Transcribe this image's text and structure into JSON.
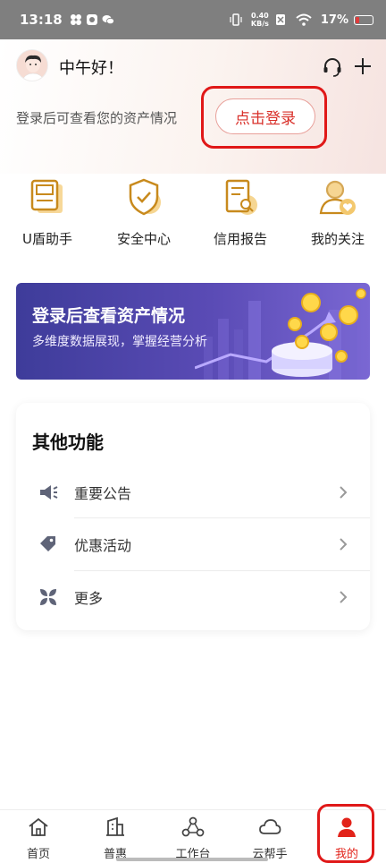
{
  "status_bar": {
    "time": "13:18",
    "net_speed_top": "0.40",
    "net_speed_bottom": "KB/s",
    "battery": "17%"
  },
  "header": {
    "greeting": "中午好！",
    "login_hint": "登录后可查看您的资产情况",
    "login_button": "点击登录"
  },
  "quick_actions": [
    {
      "label": "U盾助手",
      "icon": "u-shield-icon"
    },
    {
      "label": "安全中心",
      "icon": "security-shield-icon"
    },
    {
      "label": "信用报告",
      "icon": "credit-report-icon"
    },
    {
      "label": "我的关注",
      "icon": "my-favorites-icon"
    }
  ],
  "banner": {
    "title": "登录后查看资产情况",
    "subtitle": "多维度数据展现，掌握经营分析"
  },
  "other_functions": {
    "title": "其他功能",
    "items": [
      {
        "label": "重要公告",
        "icon": "announcement-icon"
      },
      {
        "label": "优惠活动",
        "icon": "promotion-tag-icon"
      },
      {
        "label": "更多",
        "icon": "more-grid-icon"
      }
    ]
  },
  "bottom_nav": [
    {
      "label": "首页",
      "icon": "home-icon"
    },
    {
      "label": "普惠",
      "icon": "building-icon"
    },
    {
      "label": "工作台",
      "icon": "workbench-icon"
    },
    {
      "label": "云帮手",
      "icon": "cloud-icon"
    },
    {
      "label": "我的",
      "icon": "profile-icon",
      "active": true
    }
  ],
  "colors": {
    "accent_red": "#e2231a",
    "banner_purple": "#4f45aa",
    "icon_gold": "#d9a23a"
  }
}
